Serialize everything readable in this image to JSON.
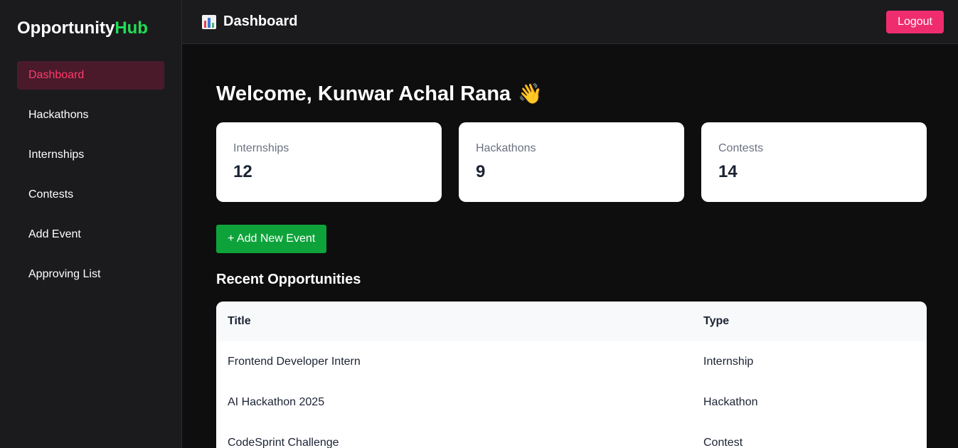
{
  "brand": {
    "name_main": "Opportunity",
    "name_accent": "Hub",
    "accent_color": "#22dd55"
  },
  "sidebar": {
    "items": [
      {
        "label": "Dashboard",
        "active": true
      },
      {
        "label": "Hackathons"
      },
      {
        "label": "Internships"
      },
      {
        "label": "Contests"
      },
      {
        "label": "Add Event"
      },
      {
        "label": "Approving List"
      }
    ]
  },
  "topbar": {
    "icon": "bar-chart-icon",
    "title": "Dashboard",
    "logout_label": "Logout"
  },
  "welcome": {
    "text": "Welcome, Kunwar Achal Rana",
    "emoji": "👋"
  },
  "stats": [
    {
      "label": "Internships",
      "value": "12"
    },
    {
      "label": "Hackathons",
      "value": "9"
    },
    {
      "label": "Contests",
      "value": "14"
    }
  ],
  "add_event_label": "+ Add New Event",
  "recent": {
    "title": "Recent Opportunities",
    "columns": [
      "Title",
      "Type"
    ],
    "rows": [
      {
        "title": "Frontend Developer Intern",
        "type": "Internship"
      },
      {
        "title": "AI Hackathon 2025",
        "type": "Hackathon"
      },
      {
        "title": "CodeSprint Challenge",
        "type": "Contest"
      }
    ]
  },
  "colors": {
    "logout": "#ef2d6e",
    "add_button": "#0ea33a",
    "active_nav_bg": "#4a1a2b",
    "active_nav_text": "#ff3b6b"
  }
}
